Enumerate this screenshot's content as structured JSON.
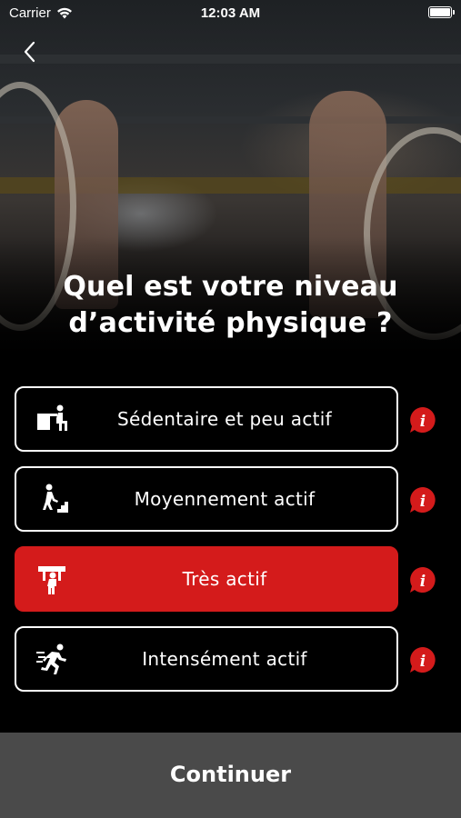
{
  "status_bar": {
    "carrier": "Carrier",
    "time": "12:03 AM"
  },
  "question": {
    "line1": "Quel est votre niveau",
    "line2": "d’activité physique ?"
  },
  "options": [
    {
      "label": "Sédentaire et peu actif",
      "icon": "desk-sitting-icon",
      "selected": false
    },
    {
      "label": "Moyennement actif",
      "icon": "stairs-walking-icon",
      "selected": false
    },
    {
      "label": "Très actif",
      "icon": "carrying-load-icon",
      "selected": true
    },
    {
      "label": "Intensément actif",
      "icon": "running-fast-icon",
      "selected": false
    }
  ],
  "continue_label": "Continuer",
  "colors": {
    "accent": "#d41b1b",
    "continue_bg": "#4a4a4a",
    "background": "#000000"
  }
}
